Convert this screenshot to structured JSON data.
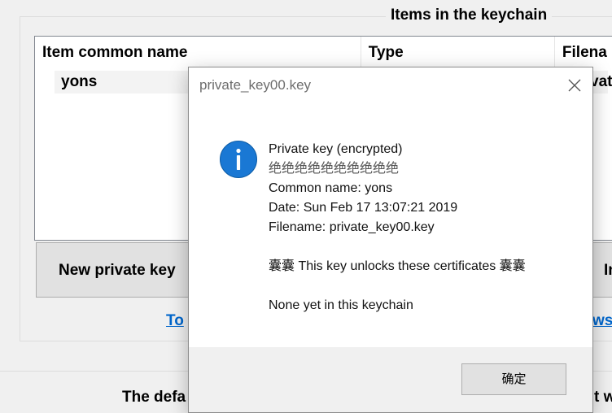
{
  "keychain": {
    "group_title": "Items in the keychain",
    "columns": [
      "Item common name",
      "Type",
      "Filena"
    ],
    "rows": [
      {
        "name": "yons",
        "file": "vat"
      }
    ],
    "new_key_button": "New private key",
    "import_button": "In",
    "link_left": "To",
    "link_right": "ws",
    "bottom_text_left": "The defa",
    "bottom_text_right": "t w"
  },
  "dialog": {
    "title": "private_key00.key",
    "icon": "info-icon",
    "lines": [
      "Private key (encrypted)",
      "绝绝绝绝绝绝绝绝绝绝",
      "Common name: yons",
      "Date: Sun Feb 17 13:07:21 2019",
      "Filename: private_key00.key",
      "",
      "囊囊 This key unlocks these certificates 囊囊",
      "",
      "None yet in this keychain"
    ],
    "ok_label": "确定"
  },
  "colors": {
    "accent": "#1a78d4",
    "link": "#0066cc",
    "background": "#f0f0f0"
  }
}
